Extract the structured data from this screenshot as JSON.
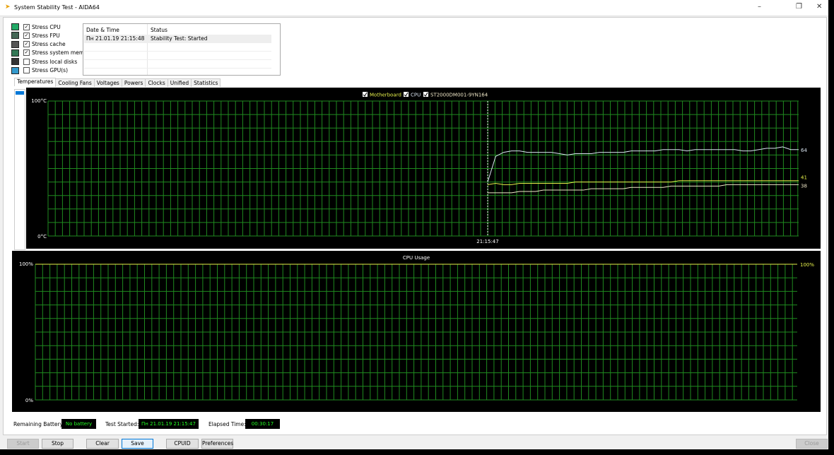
{
  "window": {
    "title": "System Stability Test - AIDA64",
    "minimize": "–",
    "restore": "❐",
    "close": "✕"
  },
  "options": [
    {
      "label": "Stress CPU",
      "checked": true,
      "icon": "cpu-icon"
    },
    {
      "label": "Stress FPU",
      "checked": true,
      "icon": "fpu-icon"
    },
    {
      "label": "Stress cache",
      "checked": true,
      "icon": "cache-icon"
    },
    {
      "label": "Stress system memory",
      "checked": true,
      "icon": "memory-icon"
    },
    {
      "label": "Stress local disks",
      "checked": false,
      "icon": "disk-icon"
    },
    {
      "label": "Stress GPU(s)",
      "checked": false,
      "icon": "gpu-icon"
    }
  ],
  "log": {
    "headers": [
      "Date & Time",
      "Status"
    ],
    "rows": [
      {
        "datetime": "Пн 21.01.19 21:15:48",
        "status": "Stability Test: Started"
      }
    ]
  },
  "tabs": [
    "Temperatures",
    "Cooling Fans",
    "Voltages",
    "Powers",
    "Clocks",
    "Unified",
    "Statistics"
  ],
  "active_tab": "Temperatures",
  "chart_data": [
    {
      "type": "line",
      "ylim": [
        0,
        100
      ],
      "ytick_labels": [
        "100°C",
        "0°C"
      ],
      "xtick_labels": [
        "21:15:47"
      ],
      "grid": true,
      "legend_placement": "top-center",
      "series": [
        {
          "name": "Motherboard",
          "color": "#e6f04a",
          "end_label": "41",
          "values": [
            38,
            39,
            38,
            38,
            39,
            39,
            39,
            39,
            39,
            39,
            39,
            40,
            40,
            40,
            40,
            40,
            40,
            40,
            40,
            40,
            40,
            40,
            40,
            40,
            41,
            41,
            41,
            41,
            41,
            41,
            41,
            41,
            41,
            41,
            41,
            41,
            41,
            41,
            41,
            41
          ]
        },
        {
          "name": "CPU",
          "color": "#d8e4f0",
          "end_label": "64",
          "values": [
            40,
            59,
            62,
            63,
            63,
            62,
            62,
            62,
            62,
            61,
            60,
            61,
            61,
            61,
            62,
            62,
            62,
            62,
            63,
            63,
            63,
            63,
            64,
            64,
            64,
            63,
            64,
            64,
            64,
            64,
            64,
            64,
            63,
            63,
            64,
            65,
            65,
            66,
            64,
            64
          ]
        },
        {
          "name": "ST2000DM001-9YN164",
          "color": "#f0e8c8",
          "end_label": "38",
          "values": [
            32,
            32,
            32,
            32,
            33,
            33,
            33,
            34,
            34,
            34,
            34,
            34,
            34,
            35,
            35,
            35,
            35,
            35,
            36,
            36,
            36,
            36,
            36,
            37,
            37,
            37,
            37,
            37,
            37,
            37,
            38,
            38,
            38,
            38,
            38,
            38,
            38,
            38,
            38,
            38
          ]
        }
      ]
    },
    {
      "type": "line",
      "title": "CPU Usage",
      "ylim": [
        0,
        100
      ],
      "ytick_labels": [
        "100%",
        "0%"
      ],
      "grid": true,
      "series": [
        {
          "color": "#e6f04a",
          "end_label": "100%",
          "values": [
            100,
            100,
            100,
            100,
            100,
            100,
            100,
            100,
            100,
            100
          ]
        }
      ]
    }
  ],
  "status": {
    "battery_label": "Remaining Battery:",
    "battery_value": "No battery",
    "started_label": "Test Started:",
    "started_value": "Пн 21.01.19 21:15:47",
    "elapsed_label": "Elapsed Time:",
    "elapsed_value": "00:30:17"
  },
  "buttons": {
    "start": "Start",
    "stop": "Stop",
    "clear": "Clear",
    "save": "Save",
    "cpuid": "CPUID",
    "preferences": "Preferences",
    "close": "Close"
  }
}
